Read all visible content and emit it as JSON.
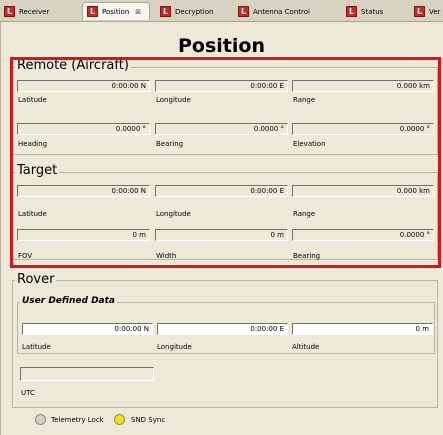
{
  "tabs": [
    {
      "label": "Receiver",
      "active": false
    },
    {
      "label": "Position",
      "active": true,
      "close": "⊠"
    },
    {
      "label": "Decryption",
      "active": false
    },
    {
      "label": "Antenna Control",
      "active": false
    },
    {
      "label": "Status",
      "active": false
    },
    {
      "label": "Ver",
      "active": false
    }
  ],
  "page_title": "Position",
  "remote": {
    "legend": "Remote (Aircraft)",
    "row1": [
      {
        "value": "0:00:00 N",
        "label": "Latitude"
      },
      {
        "value": "0:00:00 E",
        "label": "Longitude"
      },
      {
        "value": "0.000 km",
        "label": "Range"
      }
    ],
    "row2": [
      {
        "value": "0.0000 °",
        "label": "Heading"
      },
      {
        "value": "0.0000 °",
        "label": "Bearing"
      },
      {
        "value": "0.0000 °",
        "label": "Elevation"
      }
    ]
  },
  "target": {
    "legend": "Target",
    "row1": [
      {
        "value": "0:00:00 N",
        "label": "Latitude"
      },
      {
        "value": "0:00:00 E",
        "label": "Longitude"
      },
      {
        "value": "0.000 km",
        "label": "Range"
      }
    ],
    "row2": [
      {
        "value": "0 m",
        "label": "FOV"
      },
      {
        "value": "0 m",
        "label": "Width"
      },
      {
        "value": "0.0000 °",
        "label": "Bearing"
      }
    ]
  },
  "rover": {
    "legend": "Rover",
    "user_defined_legend": "User Defined Data",
    "row1": [
      {
        "value": "0:00:00 N",
        "label": "Latitude"
      },
      {
        "value": "0:00:00 E",
        "label": "Longitude"
      },
      {
        "value": "0 m",
        "label": "Altitude"
      }
    ],
    "utc": {
      "value": "",
      "label": "UTC"
    }
  },
  "status": {
    "telemetry_label": "Telemetry Lock",
    "telemetry_color": "#d4d0c8",
    "snd_label": "SND Sync",
    "snd_color": "#f5e400"
  },
  "colors": {
    "highlight": "#e0101a",
    "tab_icon": "#cc2a1e"
  }
}
